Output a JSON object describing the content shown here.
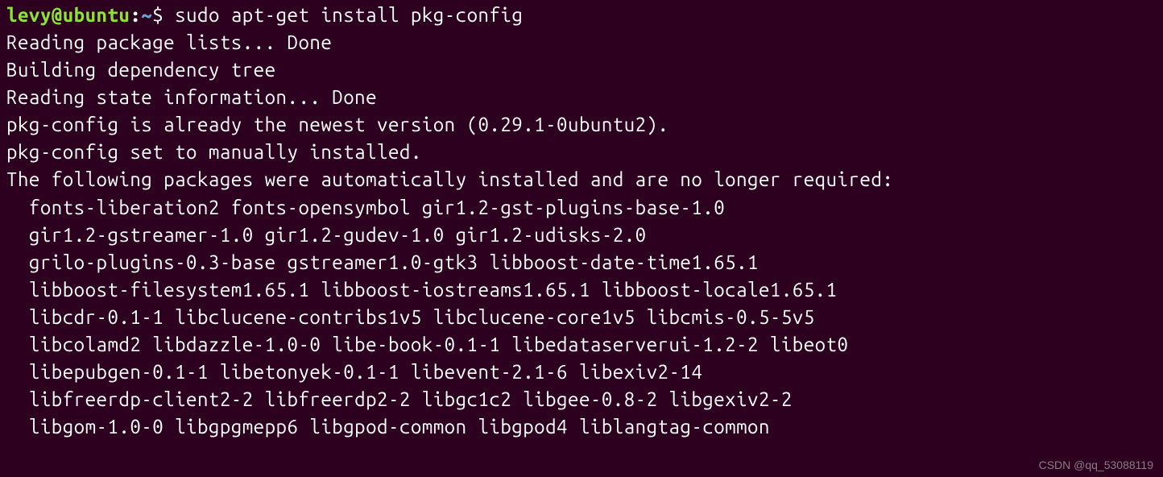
{
  "prompt": {
    "user_host": "levy@ubuntu",
    "colon": ":",
    "path": "~",
    "dollar": "$ ",
    "command": "sudo apt-get install pkg-config"
  },
  "output": {
    "lines": [
      "Reading package lists... Done",
      "Building dependency tree",
      "Reading state information... Done",
      "pkg-config is already the newest version (0.29.1-0ubuntu2).",
      "pkg-config set to manually installed.",
      "The following packages were automatically installed and are no longer required:",
      "  fonts-liberation2 fonts-opensymbol gir1.2-gst-plugins-base-1.0",
      "  gir1.2-gstreamer-1.0 gir1.2-gudev-1.0 gir1.2-udisks-2.0",
      "  grilo-plugins-0.3-base gstreamer1.0-gtk3 libboost-date-time1.65.1",
      "  libboost-filesystem1.65.1 libboost-iostreams1.65.1 libboost-locale1.65.1",
      "  libcdr-0.1-1 libclucene-contribs1v5 libclucene-core1v5 libcmis-0.5-5v5",
      "  libcolamd2 libdazzle-1.0-0 libe-book-0.1-1 libedataserverui-1.2-2 libeot0",
      "  libepubgen-0.1-1 libetonyek-0.1-1 libevent-2.1-6 libexiv2-14",
      "  libfreerdp-client2-2 libfreerdp2-2 libgc1c2 libgee-0.8-2 libgexiv2-2",
      "  libgom-1.0-0 libgpgmepp6 libgpod-common libgpod4 liblangtag-common"
    ]
  },
  "watermark": "CSDN @qq_53088119"
}
